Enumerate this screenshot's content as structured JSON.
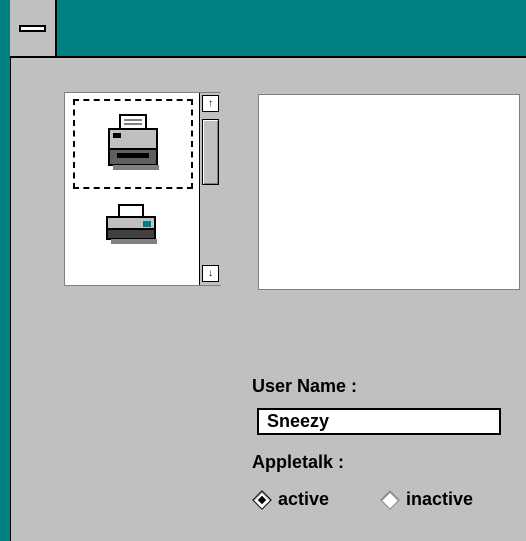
{
  "printers": [
    {
      "icon": "printer-icon",
      "selected": true
    },
    {
      "icon": "printer-icon",
      "selected": false
    }
  ],
  "scrollbar": {
    "up_arrow": "↑",
    "down_arrow": "↓"
  },
  "form": {
    "username_label": "User Name :",
    "username_value": "Sneezy",
    "appletalk_label": "Appletalk :",
    "options": [
      {
        "label": "active",
        "checked": true
      },
      {
        "label": "inactive",
        "checked": false
      }
    ]
  },
  "colors": {
    "titlebar": "#008080",
    "face": "#c0c0c0"
  }
}
